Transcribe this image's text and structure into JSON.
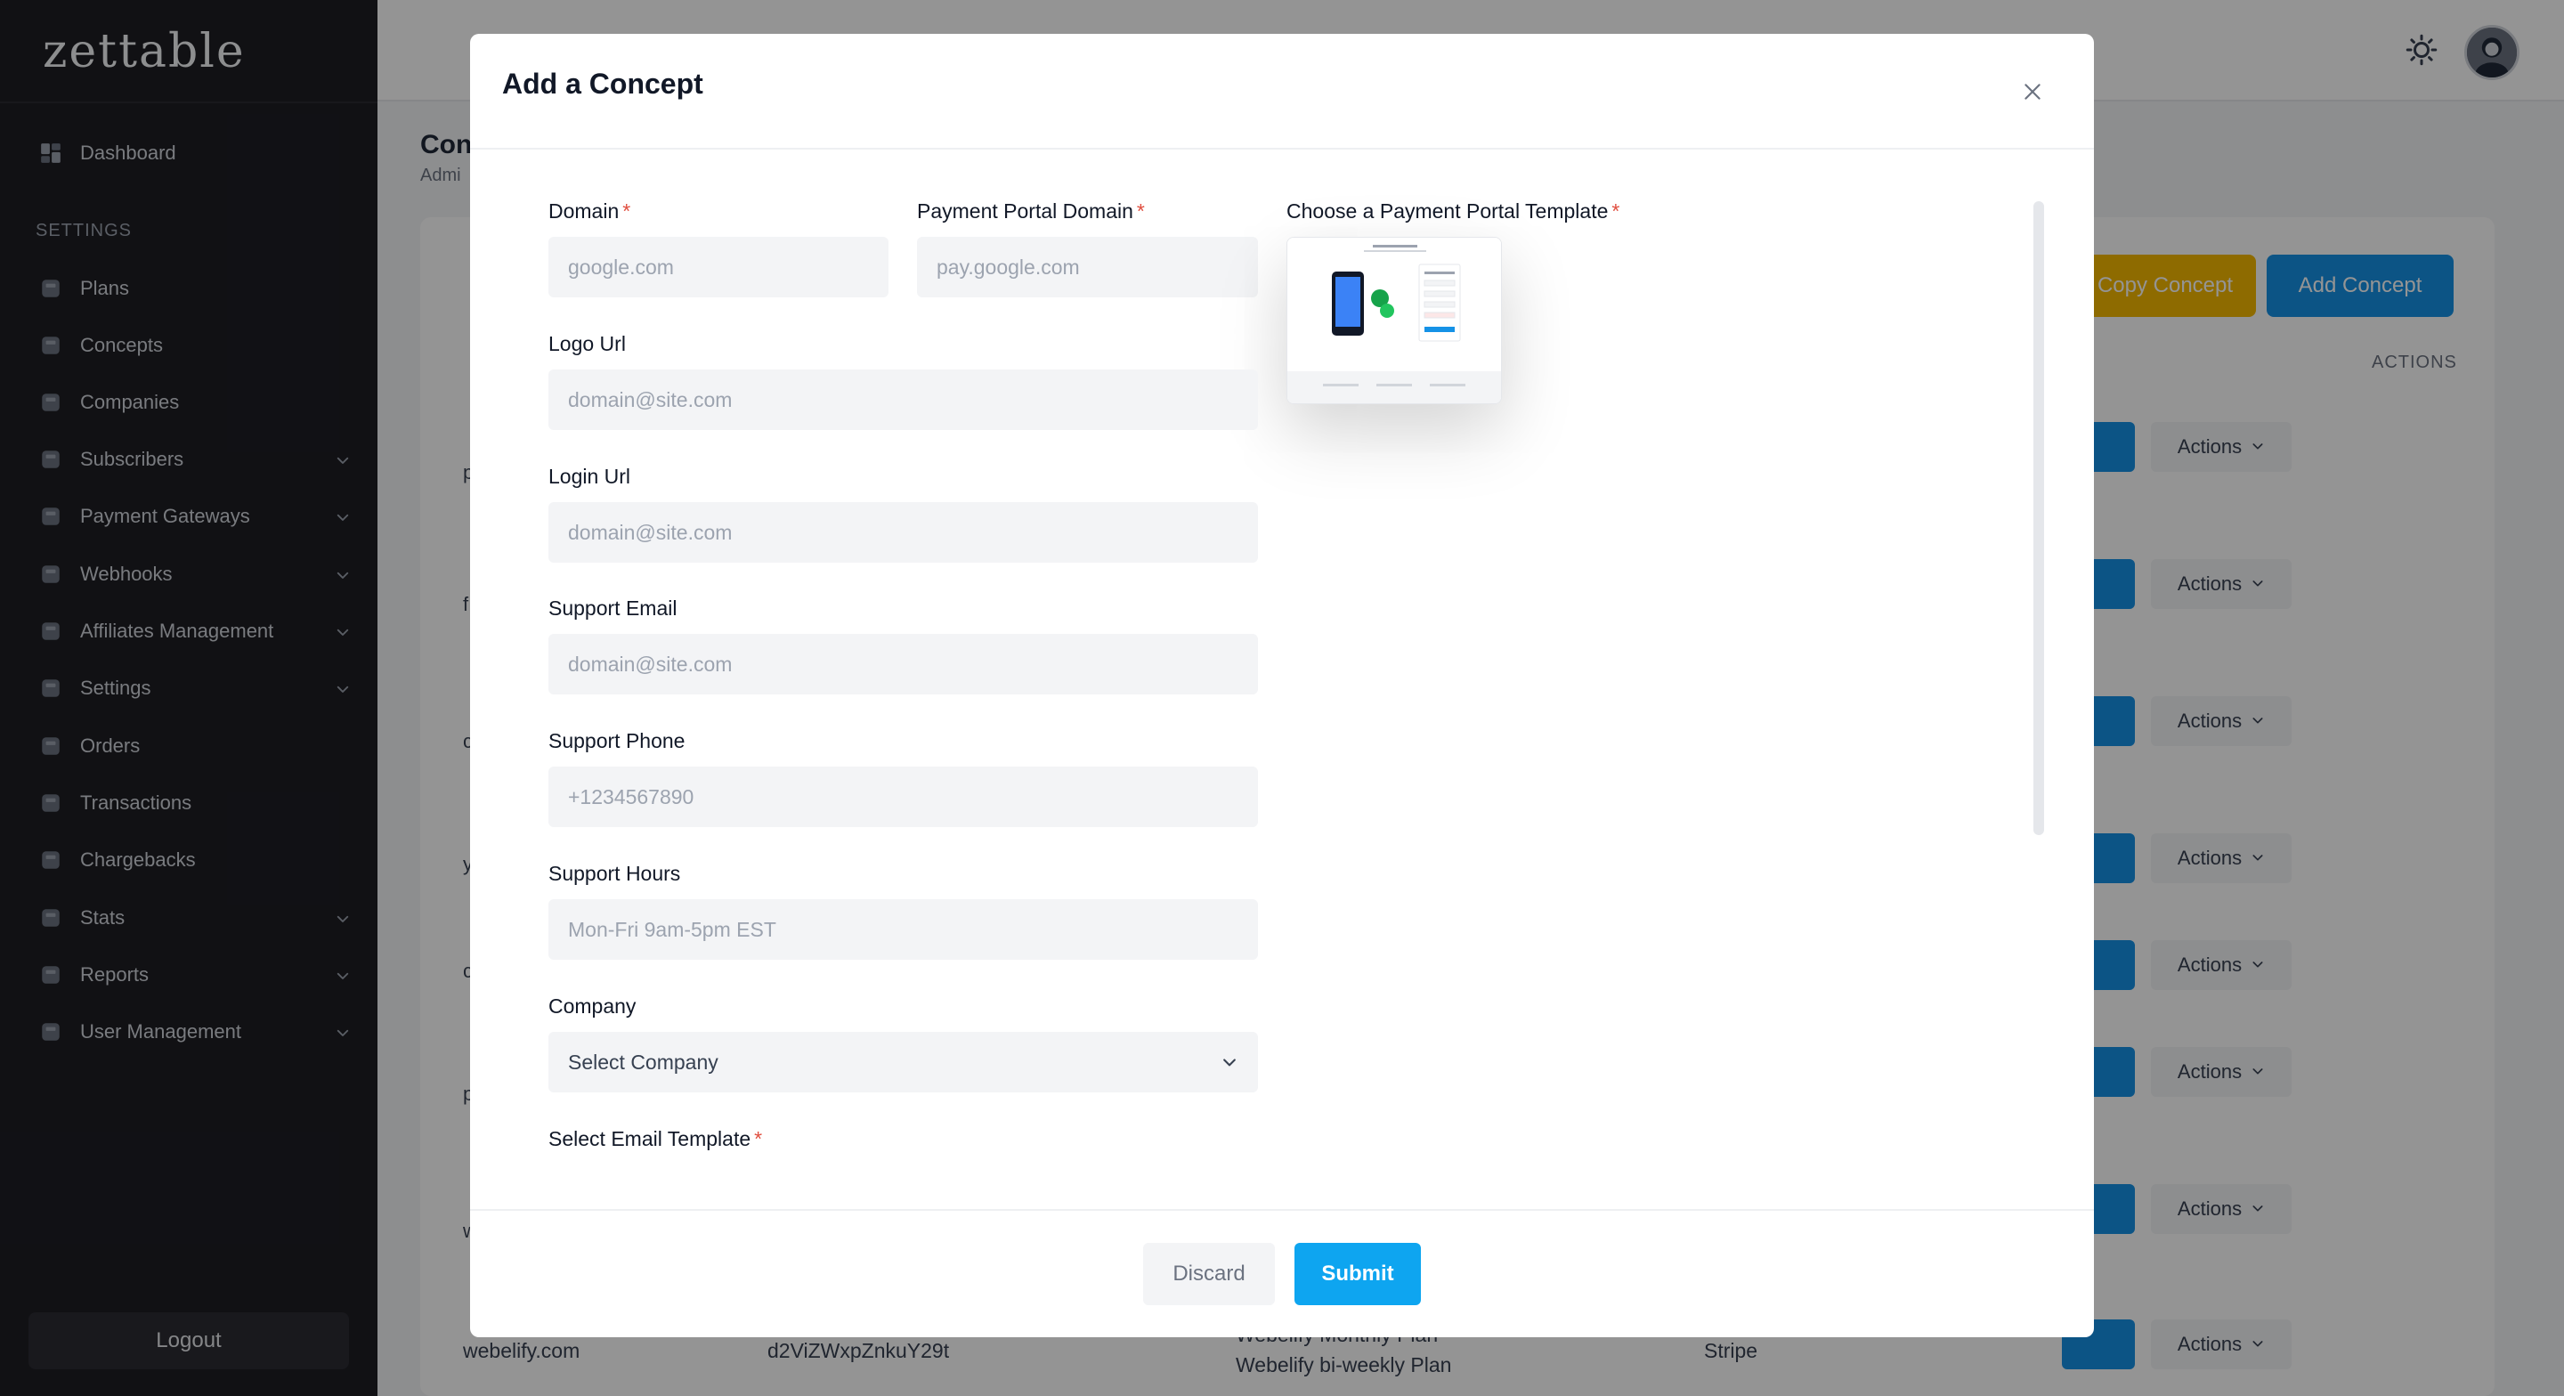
{
  "brand": "zettable",
  "sidebar": {
    "dashboard": "Dashboard",
    "section_label": "SETTINGS",
    "items": [
      {
        "label": "Plans",
        "icon": "plans-icon",
        "has_chevron": false
      },
      {
        "label": "Concepts",
        "icon": "concepts-icon",
        "has_chevron": false
      },
      {
        "label": "Companies",
        "icon": "companies-icon",
        "has_chevron": false
      },
      {
        "label": "Subscribers",
        "icon": "subscribers-icon",
        "has_chevron": true
      },
      {
        "label": "Payment Gateways",
        "icon": "payment-gateways-icon",
        "has_chevron": true
      },
      {
        "label": "Webhooks",
        "icon": "webhooks-icon",
        "has_chevron": true
      },
      {
        "label": "Affiliates Management",
        "icon": "affiliates-icon",
        "has_chevron": true
      },
      {
        "label": "Settings",
        "icon": "settings-icon",
        "has_chevron": true
      },
      {
        "label": "Orders",
        "icon": "orders-icon",
        "has_chevron": false
      },
      {
        "label": "Transactions",
        "icon": "transactions-icon",
        "has_chevron": false
      },
      {
        "label": "Chargebacks",
        "icon": "chargebacks-icon",
        "has_chevron": false
      },
      {
        "label": "Stats",
        "icon": "stats-icon",
        "has_chevron": true
      },
      {
        "label": "Reports",
        "icon": "reports-icon",
        "has_chevron": true
      },
      {
        "label": "User Management",
        "icon": "user-management-icon",
        "has_chevron": true
      }
    ],
    "logout": "Logout"
  },
  "background": {
    "page_title": "Con",
    "breadcrumb": "Admi",
    "copy_concept": "Copy Concept",
    "add_concept": "Add Concept",
    "actions_header": "ACTIONS",
    "row_action_label": "Actions",
    "row_letters": [
      "p",
      "f",
      "c",
      "y",
      "c",
      "p",
      "w"
    ],
    "bottom_row": {
      "domain": "webelify.com",
      "key": "d2ViZWxpZnkuY29t",
      "plan_top": "Webelify Monthly Plan",
      "plan": "Webelify bi-weekly Plan",
      "gateway": "Stripe"
    }
  },
  "modal": {
    "title": "Add a Concept",
    "fields": {
      "domain": {
        "label": "Domain",
        "placeholder": "google.com"
      },
      "payment_portal_domain": {
        "label": "Payment Portal Domain",
        "placeholder": "pay.google.com"
      },
      "template": {
        "label": "Choose a Payment Portal Template"
      },
      "logo_url": {
        "label": "Logo Url",
        "placeholder": "domain@site.com"
      },
      "login_url": {
        "label": "Login Url",
        "placeholder": "domain@site.com"
      },
      "support_email": {
        "label": "Support Email",
        "placeholder": "domain@site.com"
      },
      "support_phone": {
        "label": "Support Phone",
        "placeholder": "+1234567890"
      },
      "support_hours": {
        "label": "Support Hours",
        "placeholder": "Mon-Fri 9am-5pm EST"
      },
      "company": {
        "label": "Company",
        "value": "Select Company"
      },
      "email_template": {
        "label": "Select Email Template"
      }
    },
    "required_marker": "*",
    "discard": "Discard",
    "submit": "Submit"
  },
  "colors": {
    "sidebar_bg": "#1e1e24",
    "primary": "#1592e6",
    "submit": "#0ea5f0",
    "copy_button": "#f5b800",
    "required": "#e04e3f"
  }
}
